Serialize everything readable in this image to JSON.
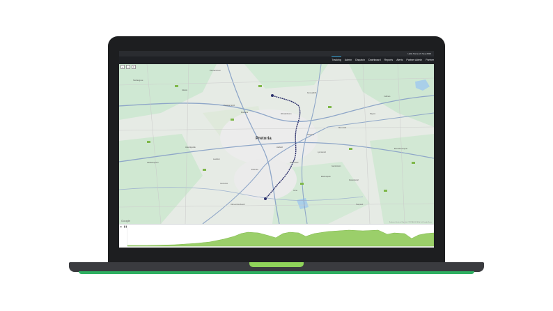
{
  "app": {
    "user": "Hello Name",
    "date": "21 Sep 2023"
  },
  "nav": {
    "items": [
      {
        "label": "Tracking",
        "active": true
      },
      {
        "label": "Admin",
        "active": false
      },
      {
        "label": "Dispatch",
        "active": false
      },
      {
        "label": "Dashboard",
        "active": false
      },
      {
        "label": "Reports",
        "active": false
      },
      {
        "label": "Alerts",
        "active": false
      },
      {
        "label": "Partner Admin",
        "active": false
      },
      {
        "label": "Partner",
        "active": false
      }
    ]
  },
  "map": {
    "city": "Pretoria",
    "provider": "Google",
    "attribution": "Keyboard shortcuts   Map data ©2023 AfriGIS (Pty) Ltd, Google   Terms",
    "labels": [
      "Soshanguve",
      "Akasia",
      "Pretoria North",
      "Montana",
      "Wonderboom",
      "Mamelodi",
      "Silverton",
      "Hatfield",
      "Lynnwood",
      "Centurion",
      "Atteridgeville",
      "Laudium",
      "Irene",
      "Olievenhoutbosch",
      "Rayton",
      "Cullinan",
      "Bronkhorstspruit",
      "Garsfontein",
      "Elarduspark",
      "Waterkloof",
      "Erasmia",
      "Hartbeespoort",
      "Kameeldrift",
      "Pienaarsrivier",
      "Zwavelpoort",
      "Tierpoort"
    ]
  },
  "colors": {
    "route": "#2b2f6b",
    "chart_fill": "#9bcf6a",
    "nav_active": "#35a3d8",
    "brand_green": "#2eb061",
    "notch": "#8fd35a"
  }
}
